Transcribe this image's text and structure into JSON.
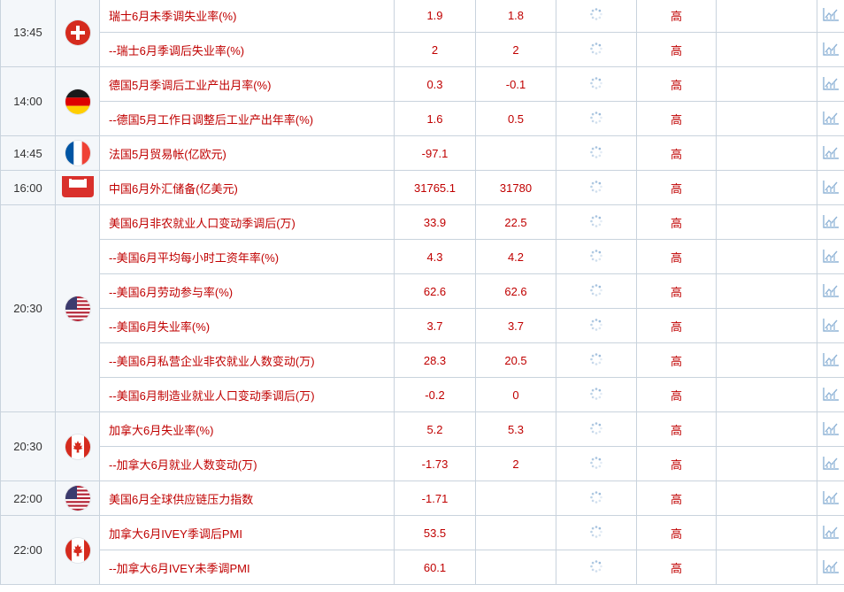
{
  "importance_label": "高",
  "rows": [
    {
      "time": "13:45",
      "flag": "switzerland-flag-icon",
      "event": "瑞士6月未季调失业率(%)",
      "actual": "1.9",
      "forecast": "1.8"
    },
    {
      "time": "",
      "flag": "",
      "event": "--瑞士6月季调后失业率(%)",
      "actual": "2",
      "forecast": "2"
    },
    {
      "time": "14:00",
      "flag": "germany-flag-icon",
      "event": "德国5月季调后工业产出月率(%)",
      "actual": "0.3",
      "forecast": "-0.1"
    },
    {
      "time": "",
      "flag": "",
      "event": "--德国5月工作日调整后工业产出年率(%)",
      "actual": "1.6",
      "forecast": "0.5"
    },
    {
      "time": "14:45",
      "flag": "france-flag-icon",
      "event": "法国5月贸易帐(亿欧元)",
      "actual": "-97.1",
      "forecast": ""
    },
    {
      "time": "16:00",
      "flag": "china-flag-icon",
      "event": "中国6月外汇储备(亿美元)",
      "actual": "31765.1",
      "forecast": "31780"
    },
    {
      "time": "20:30",
      "flag": "usa-flag-icon",
      "event": "美国6月非农就业人口变动季调后(万)",
      "actual": "33.9",
      "forecast": "22.5"
    },
    {
      "time": "",
      "flag": "",
      "event": "--美国6月平均每小时工资年率(%)",
      "actual": "4.3",
      "forecast": "4.2"
    },
    {
      "time": "",
      "flag": "",
      "event": "--美国6月劳动参与率(%)",
      "actual": "62.6",
      "forecast": "62.6"
    },
    {
      "time": "",
      "flag": "",
      "event": "--美国6月失业率(%)",
      "actual": "3.7",
      "forecast": "3.7"
    },
    {
      "time": "",
      "flag": "",
      "event": "--美国6月私营企业非农就业人数变动(万)",
      "actual": "28.3",
      "forecast": "20.5"
    },
    {
      "time": "",
      "flag": "",
      "event": "--美国6月制造业就业人口变动季调后(万)",
      "actual": "-0.2",
      "forecast": "0"
    },
    {
      "time": "20:30",
      "flag": "canada-flag-icon",
      "event": "加拿大6月失业率(%)",
      "actual": "5.2",
      "forecast": "5.3"
    },
    {
      "time": "",
      "flag": "",
      "event": "--加拿大6月就业人数变动(万)",
      "actual": "-1.73",
      "forecast": "2"
    },
    {
      "time": "22:00",
      "flag": "usa-flag-icon",
      "event": "美国6月全球供应链压力指数",
      "actual": "-1.71",
      "forecast": ""
    },
    {
      "time": "22:00",
      "flag": "canada-flag-icon",
      "event": "加拿大6月IVEY季调后PMI",
      "actual": "53.5",
      "forecast": ""
    },
    {
      "time": "",
      "flag": "",
      "event": "--加拿大6月IVEY未季调PMI",
      "actual": "60.1",
      "forecast": ""
    }
  ]
}
